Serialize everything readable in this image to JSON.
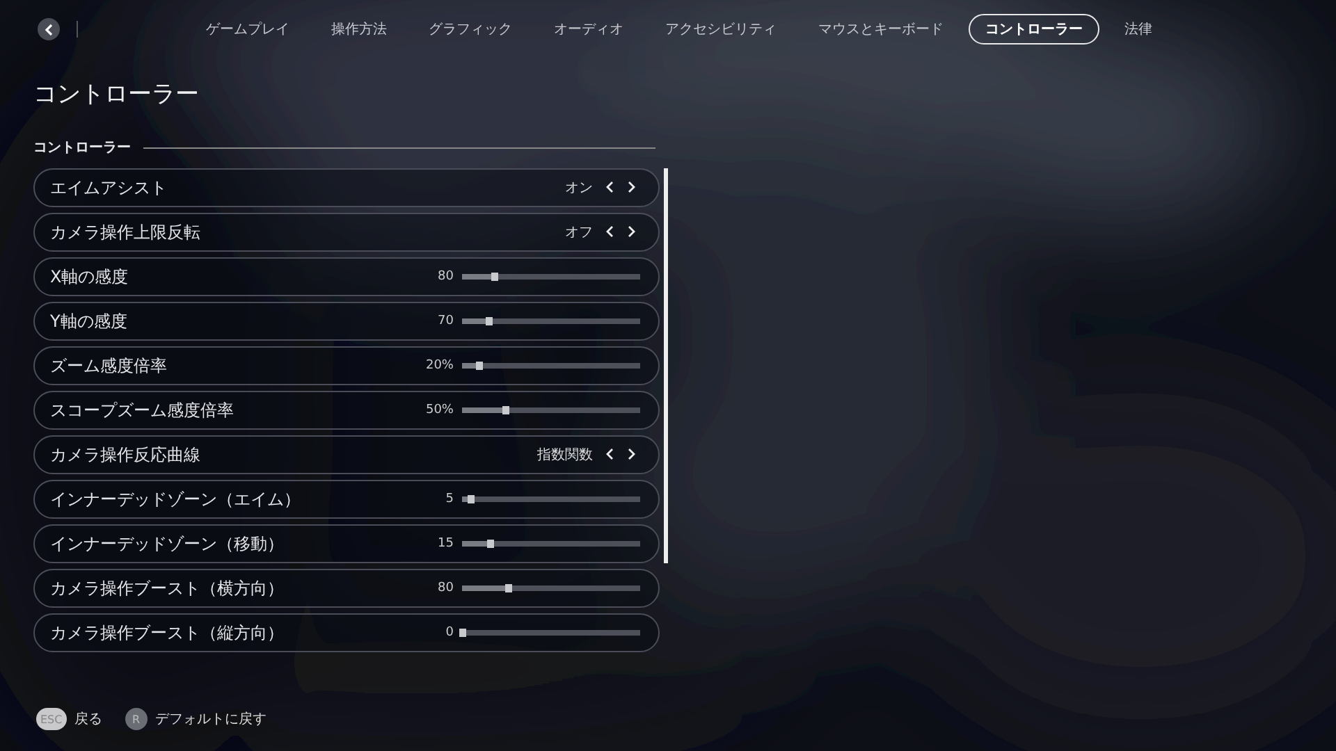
{
  "nav": {
    "tabs": [
      {
        "label": "ゲームプレイ",
        "selected": false
      },
      {
        "label": "操作方法",
        "selected": false
      },
      {
        "label": "グラフィック",
        "selected": false
      },
      {
        "label": "オーディオ",
        "selected": false
      },
      {
        "label": "アクセシビリティ",
        "selected": false
      },
      {
        "label": "マウスとキーボード",
        "selected": false
      },
      {
        "label": "コントローラー",
        "selected": true
      },
      {
        "label": "法律",
        "selected": false
      }
    ]
  },
  "page_title": "コントローラー",
  "section": {
    "title": "コントローラー",
    "settings": [
      {
        "kind": "choice",
        "label": "エイムアシスト",
        "value": "オン"
      },
      {
        "kind": "choice",
        "label": "カメラ操作上限反転",
        "value": "オフ"
      },
      {
        "kind": "slider",
        "label": "X軸の感度",
        "reading": "80",
        "level": 0.18
      },
      {
        "kind": "slider",
        "label": "Y軸の感度",
        "reading": "70",
        "level": 0.15
      },
      {
        "kind": "slider",
        "label": "ズーム感度倍率",
        "reading": "20%",
        "level": 0.09
      },
      {
        "kind": "slider",
        "label": "スコープズーム感度倍率",
        "reading": "50%",
        "level": 0.24
      },
      {
        "kind": "choice",
        "label": "カメラ操作反応曲線",
        "value": "指数関数"
      },
      {
        "kind": "slider",
        "label": "インナーデッドゾーン（エイム）",
        "reading": "5",
        "level": 0.05
      },
      {
        "kind": "slider",
        "label": "インナーデッドゾーン（移動）",
        "reading": "15",
        "level": 0.16
      },
      {
        "kind": "slider",
        "label": "カメラ操作ブースト（横方向）",
        "reading": "80",
        "level": 0.26
      },
      {
        "kind": "slider",
        "label": "カメラ操作ブースト（縦方向）",
        "reading": "0",
        "level": 0
      }
    ]
  },
  "footer": [
    {
      "key": "ESC",
      "label": "戻る",
      "kind": "pill"
    },
    {
      "key": "R",
      "label": "デフォルトに戻す",
      "kind": "circle"
    }
  ]
}
